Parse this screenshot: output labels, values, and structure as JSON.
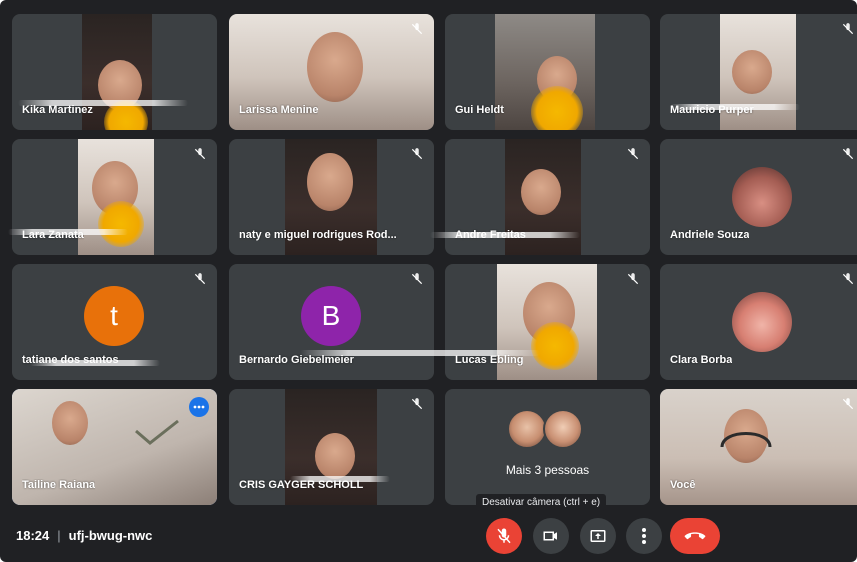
{
  "participants": [
    {
      "name": "Kika Martinez",
      "muted": false
    },
    {
      "name": "Larissa Menine",
      "muted": true
    },
    {
      "name": "Gui Heldt",
      "muted": false
    },
    {
      "name": "Mauricio Purper",
      "muted": true
    },
    {
      "name": "Lara Zanata",
      "muted": true
    },
    {
      "name": "naty e miguel rodrigues Rod...",
      "muted": true
    },
    {
      "name": "Andre Freitas",
      "muted": true
    },
    {
      "name": "Andriele Souza",
      "muted": true
    },
    {
      "name": "tatiane dos santos",
      "muted": true,
      "avatar_letter": "t",
      "avatar_color": "#e8710a"
    },
    {
      "name": "Bernardo Giebelmeier",
      "muted": true,
      "avatar_letter": "B",
      "avatar_color": "#8e24aa"
    },
    {
      "name": "Lucas Ebling",
      "muted": true
    },
    {
      "name": "Clara Borba",
      "muted": true
    },
    {
      "name": "Tailine Raiana",
      "muted": false,
      "active": true
    },
    {
      "name": "CRIS GAYGER SCHOLL",
      "muted": true
    },
    {
      "name": "Mais 3 pessoas",
      "muted": false
    },
    {
      "name": "Você",
      "muted": true
    }
  ],
  "bottom_bar": {
    "time": "18:24",
    "meeting_code": "ufj-bwug-nwc",
    "separator": "|"
  },
  "tooltip": "Desativar câmera (ctrl + e)",
  "colors": {
    "background": "#202124",
    "tile": "#3c4043",
    "danger": "#ea4335",
    "accent": "#1a73e8"
  },
  "icons": {
    "tile_mute": "mic-off-icon",
    "mic": "mic-off-icon",
    "camera": "camera-icon",
    "present": "present-screen-icon",
    "more": "more-vert-icon",
    "hangup": "call-end-icon",
    "tile_options": "more-horiz-icon"
  }
}
